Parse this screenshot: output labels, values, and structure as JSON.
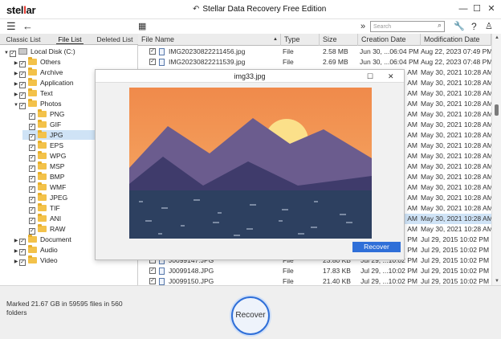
{
  "app": {
    "logo_pre": "stel",
    "logo_mark": "l",
    "logo_post": "ar",
    "title": "Stellar Data Recovery Free Edition",
    "title_icon": "undo-icon"
  },
  "toolbar": {
    "search_placeholder": "Search",
    "icons": [
      "menu-icon",
      "back-arrow-icon",
      "grid-view-icon",
      "double-chevron-icon",
      "search-icon",
      "wrench-icon",
      "help-icon",
      "user-icon"
    ]
  },
  "left_tabs": [
    "Classic List",
    "File List",
    "Deleted List"
  ],
  "tree": [
    {
      "label": "Local Disk (C:)",
      "level": 0,
      "arrow": "▼",
      "type": "drive"
    },
    {
      "label": "Others",
      "level": 1,
      "arrow": "▶",
      "type": "folder"
    },
    {
      "label": "Archive",
      "level": 1,
      "arrow": "▶",
      "type": "folder"
    },
    {
      "label": "Application",
      "level": 1,
      "arrow": "▶",
      "type": "folder"
    },
    {
      "label": "Text",
      "level": 1,
      "arrow": "▶",
      "type": "folder"
    },
    {
      "label": "Photos",
      "level": 1,
      "arrow": "▼",
      "type": "folder"
    },
    {
      "label": "PNG",
      "level": 2,
      "arrow": "",
      "type": "folder"
    },
    {
      "label": "GIF",
      "level": 2,
      "arrow": "",
      "type": "folder"
    },
    {
      "label": "JPG",
      "level": 2,
      "arrow": "",
      "type": "folder",
      "selected": true
    },
    {
      "label": "EPS",
      "level": 2,
      "arrow": "",
      "type": "folder"
    },
    {
      "label": "WPG",
      "level": 2,
      "arrow": "",
      "type": "folder"
    },
    {
      "label": "MSP",
      "level": 2,
      "arrow": "",
      "type": "folder"
    },
    {
      "label": "BMP",
      "level": 2,
      "arrow": "",
      "type": "folder"
    },
    {
      "label": "WMF",
      "level": 2,
      "arrow": "",
      "type": "folder"
    },
    {
      "label": "JPEG",
      "level": 2,
      "arrow": "",
      "type": "folder"
    },
    {
      "label": "TIF",
      "level": 2,
      "arrow": "",
      "type": "folder"
    },
    {
      "label": "ANI",
      "level": 2,
      "arrow": "",
      "type": "folder"
    },
    {
      "label": "RAW",
      "level": 2,
      "arrow": "",
      "type": "folder"
    },
    {
      "label": "Document",
      "level": 1,
      "arrow": "▶",
      "type": "folder"
    },
    {
      "label": "Audio",
      "level": 1,
      "arrow": "▶",
      "type": "folder"
    },
    {
      "label": "Video",
      "level": 1,
      "arrow": "▶",
      "type": "folder"
    }
  ],
  "columns": [
    "File Name",
    "Type",
    "Size",
    "Creation Date",
    "Modification Date"
  ],
  "rows": [
    {
      "name": "IMG20230822211456.jpg",
      "type": "File",
      "size": "2.58 MB",
      "created": "Jun 30, ...06:04 PM",
      "modified": "Aug 22, 2023 07:49 PM"
    },
    {
      "name": "IMG20230822211539.jpg",
      "type": "File",
      "size": "2.69 MB",
      "created": "Jun 30, ...06:04 PM",
      "modified": "Aug 22, 2023 07:48 PM"
    },
    {
      "name": "",
      "type": "",
      "size": "",
      "created": "AM",
      "modified": "May 30, 2021 10:28 AM"
    },
    {
      "name": "",
      "type": "",
      "size": "",
      "created": "AM",
      "modified": "May 30, 2021 10:28 AM"
    },
    {
      "name": "",
      "type": "",
      "size": "",
      "created": "AM",
      "modified": "May 30, 2021 10:28 AM"
    },
    {
      "name": "",
      "type": "",
      "size": "",
      "created": "AM",
      "modified": "May 30, 2021 10:28 AM"
    },
    {
      "name": "",
      "type": "",
      "size": "",
      "created": "AM",
      "modified": "May 30, 2021 10:28 AM"
    },
    {
      "name": "",
      "type": "",
      "size": "",
      "created": "AM",
      "modified": "May 30, 2021 10:28 AM"
    },
    {
      "name": "",
      "type": "",
      "size": "",
      "created": "AM",
      "modified": "May 30, 2021 10:28 AM"
    },
    {
      "name": "",
      "type": "",
      "size": "",
      "created": "AM",
      "modified": "May 30, 2021 10:28 AM"
    },
    {
      "name": "",
      "type": "",
      "size": "",
      "created": "AM",
      "modified": "May 30, 2021 10:28 AM"
    },
    {
      "name": "",
      "type": "",
      "size": "",
      "created": "AM",
      "modified": "May 30, 2021 10:28 AM"
    },
    {
      "name": "",
      "type": "",
      "size": "",
      "created": "AM",
      "modified": "May 30, 2021 10:28 AM"
    },
    {
      "name": "",
      "type": "",
      "size": "",
      "created": "AM",
      "modified": "May 30, 2021 10:28 AM"
    },
    {
      "name": "",
      "type": "",
      "size": "",
      "created": "AM",
      "modified": "May 30, 2021 10:28 AM"
    },
    {
      "name": "",
      "type": "",
      "size": "",
      "created": "AM",
      "modified": "May 30, 2021 10:28 AM"
    },
    {
      "name": "",
      "type": "",
      "size": "",
      "created": "AM",
      "modified": "May 30, 2021 10:28 AM",
      "highlight": true
    },
    {
      "name": "",
      "type": "",
      "size": "",
      "created": "AM",
      "modified": "May 30, 2021 10:28 AM"
    },
    {
      "name": "",
      "type": "",
      "size": "",
      "created": "PM",
      "modified": "Jul 29, 2015 10:02 PM"
    },
    {
      "name": "",
      "type": "",
      "size": "",
      "created": "PM",
      "modified": "Jul 29, 2015 10:02 PM"
    },
    {
      "name": "J0099147.JPG",
      "type": "File",
      "size": "23.80 KB",
      "created": "Jul 29, ...10:02 PM",
      "modified": "Jul 29, 2015 10:02 PM"
    },
    {
      "name": "J0099148.JPG",
      "type": "File",
      "size": "17.83 KB",
      "created": "Jul 29, ...10:02 PM",
      "modified": "Jul 29, 2015 10:02 PM"
    },
    {
      "name": "J0099150.JPG",
      "type": "File",
      "size": "21.40 KB",
      "created": "Jul 29, ...10:02 PM",
      "modified": "Jul 29, 2015 10:02 PM"
    }
  ],
  "status_text": "Marked 21.67 GB in 59595 files in 560 folders",
  "recover_label": "Recover",
  "preview": {
    "title": "img33.jpg",
    "recover_label": "Recover",
    "colors": {
      "sky_top": "#f08a4b",
      "sky_bottom": "#f7b06a",
      "sun": "#fbe08a",
      "mountains": "#6b5c8e",
      "mountain_dark": "#3f3b6b",
      "water": "#2d4060"
    }
  },
  "colors": {
    "accent": "#2f6fd8",
    "selection": "#cfe3f6",
    "logo_red": "#e2231a"
  }
}
